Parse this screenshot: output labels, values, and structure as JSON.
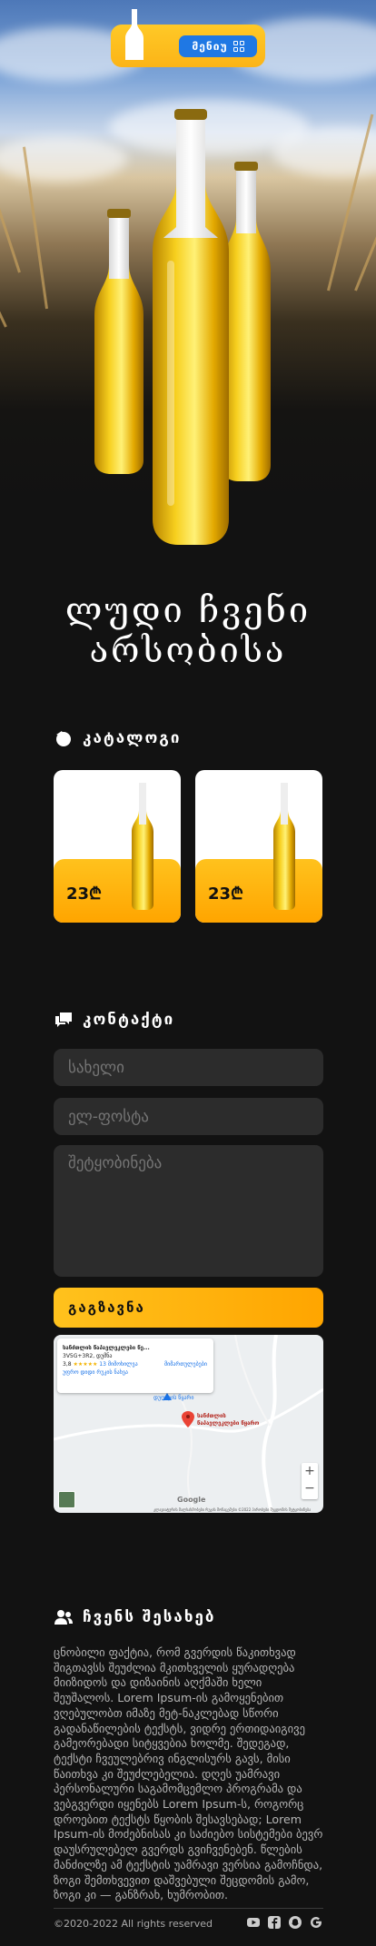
{
  "header": {
    "menu_label": "მენიუ",
    "logo_icon": "beer-bottle-icon",
    "menu_icon": "grid-icon",
    "accent": "#fbb417",
    "menu_button_color": "#1f78e4"
  },
  "hero": {
    "title": "ლუდი ჩვენი არსობისა"
  },
  "catalog": {
    "title": "კატალოგი",
    "icon": "catalog-icon",
    "items": [
      {
        "price": "23₾"
      },
      {
        "price": "23₾"
      }
    ]
  },
  "contact": {
    "title": "კონტაქტი",
    "icon": "chat-icon",
    "name_placeholder": "სახელი",
    "email_placeholder": "ელ-ფოსტა",
    "message_placeholder": "შეტყობინება",
    "submit_label": "გაგზავნა"
  },
  "map": {
    "place_name": "სანძთლის წაპავლეკლები წე...",
    "place_address": "3V5G+3R2, დუმნა",
    "rating": "3,8",
    "reviews": "13 მიმოხილვა",
    "directions": "მიმართულებები",
    "larger_map": "უფრო დიდი რუკის ნახვა",
    "pin_label": "სანძთლის წაპავლეკლები წყარო",
    "nearby_label": "დუღლის წყარი",
    "zoom_in": "+",
    "zoom_out": "−",
    "google": "Google",
    "footer": "კლავიატურის მალსახმობები   რუკის მონაცემები ©2022   პირობები   შეცდომის შეტყობინება"
  },
  "about": {
    "title": "ჩვენს შესახებ",
    "icon": "people-icon",
    "text": "ცნობილი ფაქტია, რომ გვერდის წაკითხვად შიგთავსს შეუძლია მკითხველის ყურადღება მიიზიდოს და დიზაინის აღქმაში ხელი შეუშალოს. Lorem Ipsum-ის გამოყენებით ვღებულობთ იმაზე მეტ-ნაკლებად სწორი გადანაწილების ტექსტს, ვიდრე ერთიდაიგივე გამეორებადი სიტყვებია ხოლმე. შედეგად, ტექსტი ჩვეულებრივ ინგლისურს გავს, მისი წაითხვა კი შეუძლებელია. დღეს უამრავი პერსონალური საგამომცემლო პროგრამა და ვებგვერდი იყენებს Lorem Ipsum-ს, როგორც დროებით ტექსტს წყობის შესავსებად; Lorem Ipsum-ის მოძებნისას კი საძიებო სისტემები ბევრ დაუსრულებელ გვერდს გვიჩვენებენ. წლების მანძილზე ამ ტექსტის უამრავი ვერსია გამოჩნდა, ზოგი შემთხვევით დაშვებული შეცდომის გამო, ზოგი კი — განზრახ, ხუმრობით."
  },
  "footer": {
    "copyright": "©2020-2022   All rights reserved",
    "icons": [
      "youtube-icon",
      "facebook-icon",
      "snapchat-icon",
      "google-icon"
    ]
  }
}
